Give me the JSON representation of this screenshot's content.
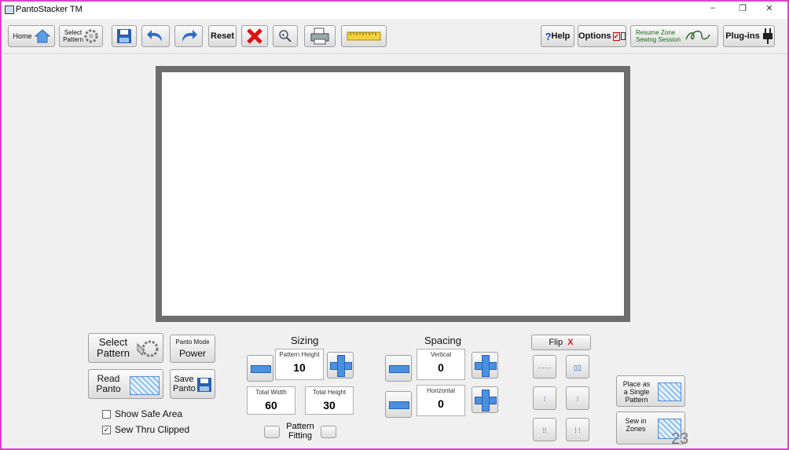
{
  "window": {
    "title": "PantoStacker TM",
    "minimize": "–",
    "restore": "❐",
    "close": "✕"
  },
  "toolbar": {
    "home": "Home",
    "select_pattern": "Select Pattern",
    "reset": "Reset",
    "help": "Help",
    "help_mark": "?",
    "options": "Options",
    "resume": "Resume Zone Sewing Session",
    "plugins": "Plug-ins"
  },
  "left": {
    "select_pattern": "Select Pattern",
    "panto_mode_caption": "Panto Mode",
    "panto_mode_value": "Power",
    "read_panto": "Read Panto",
    "save_panto": "Save Panto",
    "show_safe_area": "Show Safe Area",
    "sew_thru_clipped": "Sew Thru Clipped",
    "show_safe_area_checked": "",
    "sew_thru_clipped_checked": "✓"
  },
  "sizing": {
    "title": "Sizing",
    "pattern_height_caption": "Pattern Height",
    "pattern_height": "10",
    "total_width_caption": "Total Width",
    "total_width": "60",
    "total_height_caption": "Total Height",
    "total_height": "30",
    "pattern_fitting": "Pattern Fitting"
  },
  "spacing": {
    "title": "Spacing",
    "vertical_caption": "Vertical",
    "vertical": "0",
    "horizontal_caption": "Horizontal",
    "horizontal": "0"
  },
  "flip": {
    "label": "Flip",
    "mark": "X"
  },
  "right": {
    "place_single": "Place as a Single Pattern",
    "sew_in_zones": "Sew in Zones"
  },
  "page_number": "23",
  "colors": {
    "accent": "#4a8fe0",
    "frame": "#e040c8",
    "red": "#e01010"
  }
}
